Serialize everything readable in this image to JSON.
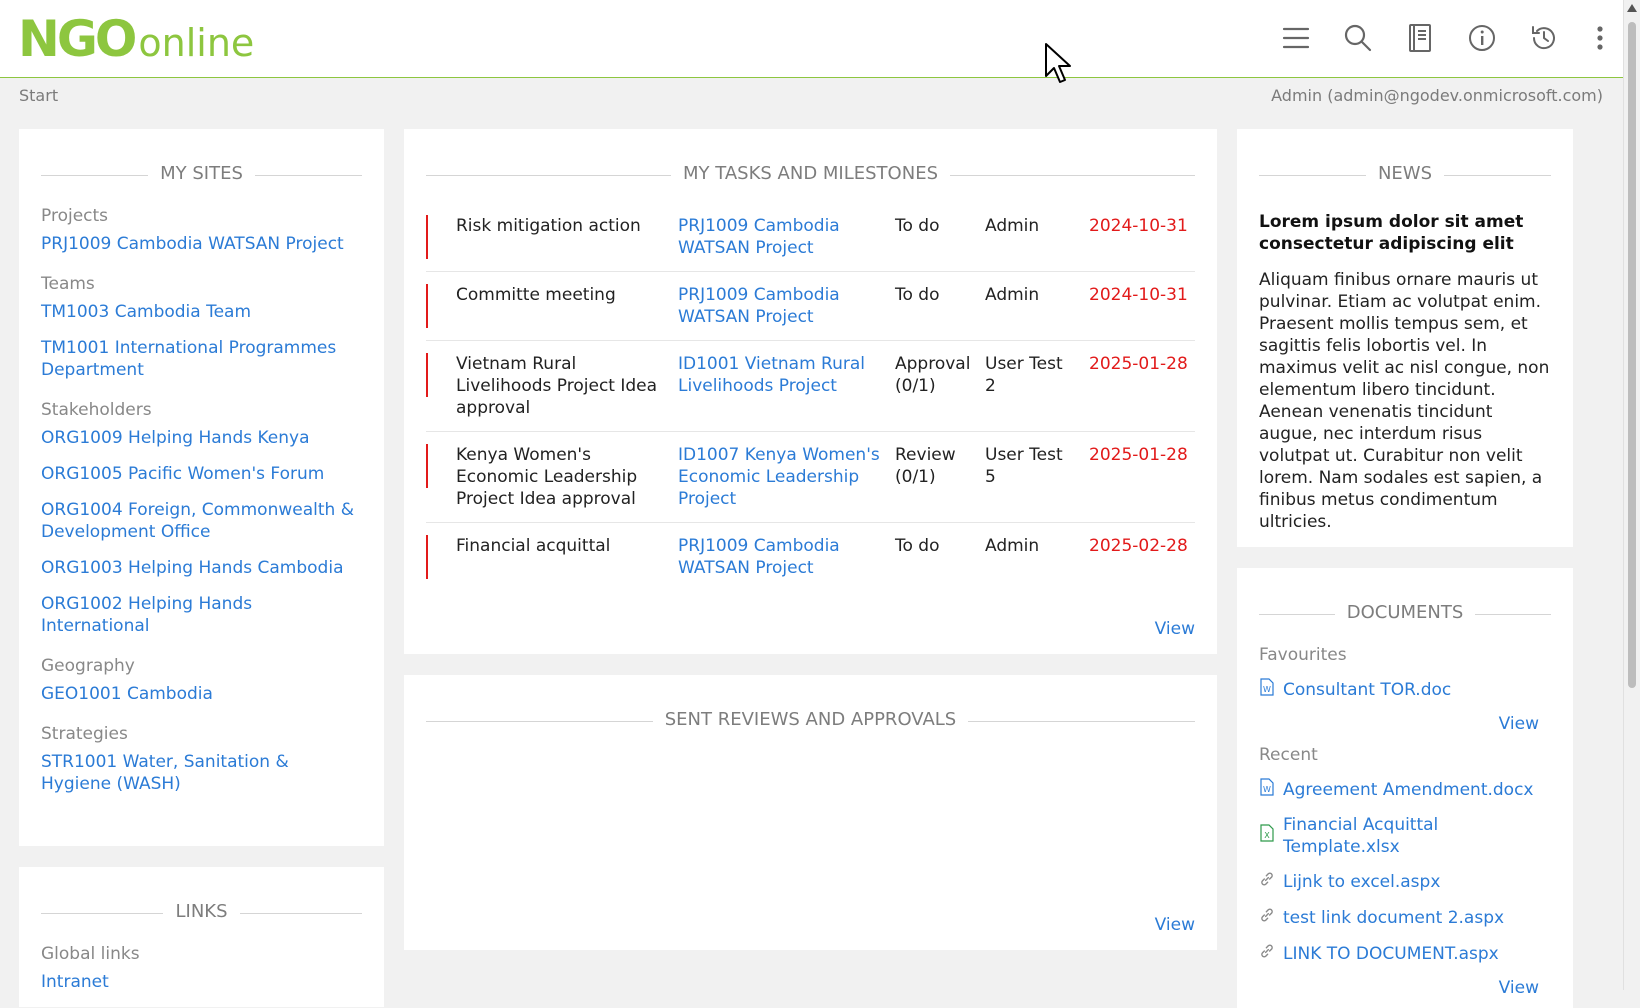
{
  "app": {
    "logo_main": "NGO",
    "logo_sub": "online"
  },
  "toolbar": {
    "menu_icon": "menu-icon",
    "search_icon": "search-icon",
    "book_icon": "book-icon",
    "info_icon": "info-icon",
    "history_icon": "history-icon",
    "more_icon": "more-vertical-icon"
  },
  "breadcrumb": {
    "label": "Start"
  },
  "user": {
    "label": "Admin (admin@ngodev.onmicrosoft.com)"
  },
  "my_sites": {
    "title": "MY SITES",
    "groups": [
      {
        "label": "Projects",
        "items": [
          "PRJ1009 Cambodia WATSAN Project"
        ]
      },
      {
        "label": "Teams",
        "items": [
          "TM1003 Cambodia Team",
          "TM1001 International Programmes Department"
        ]
      },
      {
        "label": "Stakeholders",
        "items": [
          "ORG1009 Helping Hands Kenya",
          "ORG1005 Pacific Women's Forum",
          "ORG1004 Foreign, Commonwealth & Development Office",
          "ORG1003 Helping Hands Cambodia",
          "ORG1002 Helping Hands International"
        ]
      },
      {
        "label": "Geography",
        "items": [
          "GEO1001 Cambodia"
        ]
      },
      {
        "label": "Strategies",
        "items": [
          "STR1001 Water, Sanitation & Hygiene (WASH)"
        ]
      }
    ]
  },
  "links": {
    "title": "LINKS",
    "group_label": "Global links",
    "items": [
      "Intranet"
    ]
  },
  "tasks": {
    "title": "MY TASKS AND MILESTONES",
    "rows": [
      {
        "task": "Risk mitigation action",
        "site": "PRJ1009 Cambodia WATSAN Project",
        "status": "To do",
        "assignee": "Admin",
        "due": "2024-10-31"
      },
      {
        "task": "Committe meeting",
        "site": "PRJ1009 Cambodia WATSAN Project",
        "status": "To do",
        "assignee": "Admin",
        "due": "2024-10-31"
      },
      {
        "task": "Vietnam Rural Livelihoods Project Idea approval",
        "site": "ID1001 Vietnam Rural Livelihoods Project",
        "status": "Approval (0/1)",
        "assignee": "User Test 2",
        "due": "2025-01-28"
      },
      {
        "task": "Kenya Women's Economic Leadership Project Idea approval",
        "site": "ID1007 Kenya Women's Economic Leadership Project",
        "status": "Review (0/1)",
        "assignee": "User Test 5",
        "due": "2025-01-28"
      },
      {
        "task": "Financial acquittal",
        "site": "PRJ1009 Cambodia WATSAN Project",
        "status": "To do",
        "assignee": "Admin",
        "due": "2025-02-28"
      }
    ],
    "view_label": "View"
  },
  "reviews": {
    "title": "SENT REVIEWS AND APPROVALS",
    "view_label": "View"
  },
  "news": {
    "title": "NEWS",
    "headline": "Lorem ipsum dolor sit amet consectetur adipiscing elit",
    "body": "Aliquam finibus ornare mauris ut pulvinar. Etiam ac volutpat enim. Praesent mollis tempus sem, et sagittis felis lobortis vel. In maximus velit ac nisl congue, non elementum libero tincidunt. Aenean venenatis tincidunt augue, nec interdum risus volutpat ut. Curabitur non velit lorem. Nam sodales est sapien, a finibus metus condimentum ultricies."
  },
  "documents": {
    "title": "DOCUMENTS",
    "favourites_label": "Favourites",
    "favourites": [
      {
        "name": "Consultant TOR.doc",
        "icon": "word-doc-icon"
      }
    ],
    "favourites_view": "View",
    "recent_label": "Recent",
    "recent": [
      {
        "name": "Agreement Amendment.docx",
        "icon": "word-doc-icon"
      },
      {
        "name": "Financial Acquittal Template.xlsx",
        "icon": "excel-doc-icon"
      },
      {
        "name": "Lijnk to excel.aspx",
        "icon": "link-icon"
      },
      {
        "name": "test link document 2.aspx",
        "icon": "link-icon"
      },
      {
        "name": "LINK TO DOCUMENT.aspx",
        "icon": "link-icon"
      }
    ],
    "recent_view": "View"
  },
  "colors": {
    "brand": "#8dc63f",
    "link": "#2b7bd6",
    "due": "#e21a1a"
  }
}
